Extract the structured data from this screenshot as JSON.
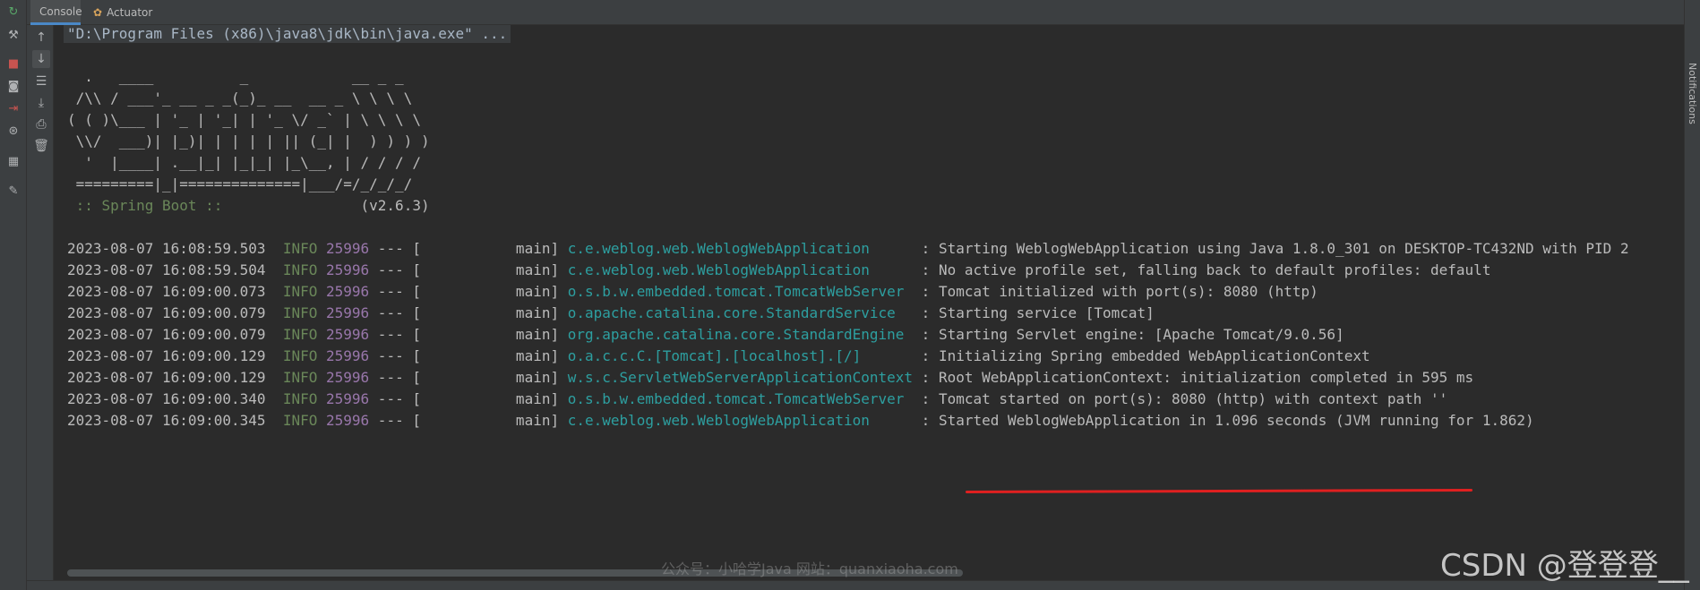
{
  "tabs": [
    {
      "label": "Console",
      "active": true
    },
    {
      "label": "Actuator",
      "active": false
    }
  ],
  "right_bar": {
    "label": "Notifications"
  },
  "left_icons": [
    "rerun-icon",
    "wrench-icon",
    "stop-icon",
    "camera-icon",
    "exit-icon",
    "debug-search-icon",
    "layout-icon",
    "pin-icon"
  ],
  "tool_icons": [
    "up-arrow-icon",
    "down-arrow-icon",
    "soft-wrap-icon",
    "scroll-to-end-icon",
    "print-icon",
    "trash-icon"
  ],
  "console": {
    "command": "\"D:\\Program Files (x86)\\java8\\jdk\\bin\\java.exe\" ...",
    "banner": [
      "  .   ____          _            __ _ _",
      " /\\\\ / ___'_ __ _ _(_)_ __  __ _ \\ \\ \\ \\",
      "( ( )\\___ | '_ | '_| | '_ \\/ _` | \\ \\ \\ \\",
      " \\\\/  ___)| |_)| | | | | || (_| |  ) ) ) )",
      "  '  |____| .__|_| |_|_| |_\\__, | / / / /",
      " =========|_|==============|___/=/_/_/_/"
    ],
    "boot_label": " :: Spring Boot :: ",
    "boot_version": "               (v2.6.3)",
    "logs": [
      {
        "ts": "2023-08-07 16:08:59.503",
        "level": "INFO",
        "pid": "25996",
        "thread": " --- [           main] ",
        "cls": "c.e.weblog.web.WeblogWebApplication     ",
        "msg": " : Starting WeblogWebApplication using Java 1.8.0_301 on DESKTOP-TC432ND with PID 2"
      },
      {
        "ts": "2023-08-07 16:08:59.504",
        "level": "INFO",
        "pid": "25996",
        "thread": " --- [           main] ",
        "cls": "c.e.weblog.web.WeblogWebApplication     ",
        "msg": " : No active profile set, falling back to default profiles: default"
      },
      {
        "ts": "2023-08-07 16:09:00.073",
        "level": "INFO",
        "pid": "25996",
        "thread": " --- [           main] ",
        "cls": "o.s.b.w.embedded.tomcat.TomcatWebServer ",
        "msg": " : Tomcat initialized with port(s): 8080 (http)"
      },
      {
        "ts": "2023-08-07 16:09:00.079",
        "level": "INFO",
        "pid": "25996",
        "thread": " --- [           main] ",
        "cls": "o.apache.catalina.core.StandardService  ",
        "msg": " : Starting service [Tomcat]"
      },
      {
        "ts": "2023-08-07 16:09:00.079",
        "level": "INFO",
        "pid": "25996",
        "thread": " --- [           main] ",
        "cls": "org.apache.catalina.core.StandardEngine ",
        "msg": " : Starting Servlet engine: [Apache Tomcat/9.0.56]"
      },
      {
        "ts": "2023-08-07 16:09:00.129",
        "level": "INFO",
        "pid": "25996",
        "thread": " --- [           main] ",
        "cls": "o.a.c.c.C.[Tomcat].[localhost].[/]      ",
        "msg": " : Initializing Spring embedded WebApplicationContext"
      },
      {
        "ts": "2023-08-07 16:09:00.129",
        "level": "INFO",
        "pid": "25996",
        "thread": " --- [           main] ",
        "cls": "w.s.c.ServletWebServerApplicationContext",
        "msg": " : Root WebApplicationContext: initialization completed in 595 ms"
      },
      {
        "ts": "2023-08-07 16:09:00.340",
        "level": "INFO",
        "pid": "25996",
        "thread": " --- [           main] ",
        "cls": "o.s.b.w.embedded.tomcat.TomcatWebServer ",
        "msg": " : Tomcat started on port(s): 8080 (http) with context path ''"
      },
      {
        "ts": "2023-08-07 16:09:00.345",
        "level": "INFO",
        "pid": "25996",
        "thread": " --- [           main] ",
        "cls": "c.e.weblog.web.WeblogWebApplication     ",
        "msg": " : Started WeblogWebApplication in 1.096 seconds (JVM running for 1.862)"
      }
    ]
  },
  "watermarks": {
    "middle": "公众号：小哈学Java 网站：quanxiaoha.com",
    "csdn": "CSDN @登登登__"
  },
  "colors": {
    "background": "#2b2b2b",
    "info": "#6a8759",
    "pid": "#9876aa",
    "logger": "#2d9fa0",
    "highlight_underline": "#e02020"
  }
}
